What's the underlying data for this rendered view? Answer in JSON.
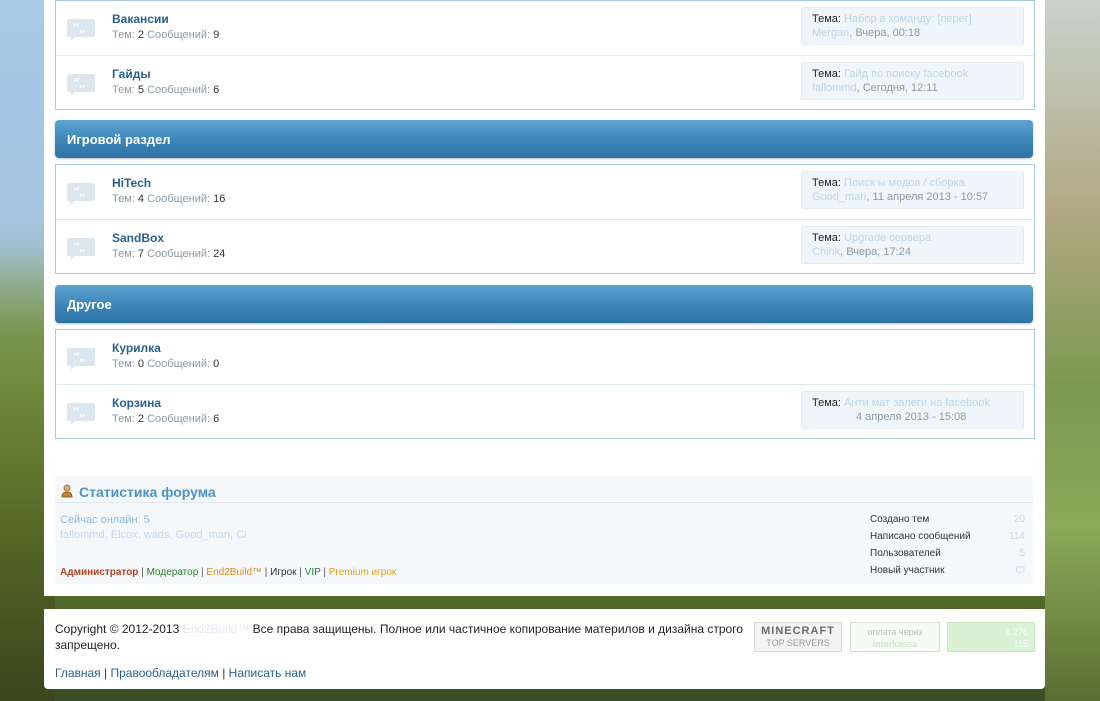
{
  "sections": [
    {
      "header": "",
      "forums": [
        {
          "title": "Вакансии",
          "topics": "2",
          "posts": "9",
          "last_label": "Тема:",
          "last_topic": "Набор в команду: [перег]",
          "last_author": "Mergan",
          "last_time": ", Вчера, 00:18"
        },
        {
          "title": "Гайды",
          "topics": "5",
          "posts": "6",
          "last_label": "Тема:",
          "last_topic": "Гайд по поиску facebook",
          "last_author": "fallommd",
          "last_time": ", Сегодня, 12:11"
        }
      ]
    },
    {
      "header": "Игровой раздел",
      "forums": [
        {
          "title": "HiTech",
          "topics": "4",
          "posts": "16",
          "last_label": "Тема:",
          "last_topic": "Поиск ы модов / сборка",
          "last_author": "Good_man",
          "last_time": ", 11 апреля 2013 - 10:57"
        },
        {
          "title": "SandBox",
          "topics": "7",
          "posts": "24",
          "last_label": "Тема:",
          "last_topic": "Upgrade сервера",
          "last_author": "Chink",
          "last_time": ", Вчера, 17:24"
        }
      ]
    },
    {
      "header": "Другое",
      "forums": [
        {
          "title": "Курилка",
          "topics": "0",
          "posts": "0",
          "last_label": "",
          "last_topic": "",
          "last_author": "",
          "last_time": ""
        },
        {
          "title": "Корзина",
          "topics": "2",
          "posts": "6",
          "last_label": "Тема:",
          "last_topic": "Анти мат залеги на facebook",
          "last_author": "",
          "last_time": "4 апреля 2013 - 15:08"
        }
      ]
    }
  ],
  "labels": {
    "topics": "Тем:",
    "posts": "Сообщений:"
  },
  "forum_icon_glyph": "“„",
  "stats": {
    "title": "Статистика форума",
    "online": "Сейчас онлайн: 5",
    "online_users": "fallommd, Elcox, wads, Good_man, Cl",
    "legend": {
      "admin": "Администратор",
      "mod": "Модератор",
      "e2b": "End2Build™",
      "player": "Игрок",
      "vip": "VIP",
      "premium": "Premium игрок",
      "sep": " | "
    },
    "labels": [
      "Создано тем",
      "Написано сообщений",
      "Пользователей",
      "Новый участник"
    ],
    "values": [
      "20",
      "114",
      "5",
      "Cl"
    ]
  },
  "footer": {
    "copyright_start": "Copyright © 2012-2013",
    "copyright_blur": " End2Build™ ",
    "copyright_end": "Все права защищены. Полное или частичное копирование материлов и дизайна строго запрещено.",
    "links": [
      "Главная",
      "Правообладателям",
      "Написать нам"
    ],
    "link_sep": " | ",
    "badges": [
      {
        "line1": "MINECRAFT",
        "line2": "TOP SERVERS"
      },
      {
        "line1": "оплата через",
        "line2": "interkassa"
      },
      {
        "line1": "1 276",
        "line2": "115"
      }
    ]
  },
  "colors": {
    "header_top": "#5ea4d1",
    "header_bottom": "#2f72a4",
    "link": "#2a5f8f",
    "accent": "#4a93c9"
  }
}
